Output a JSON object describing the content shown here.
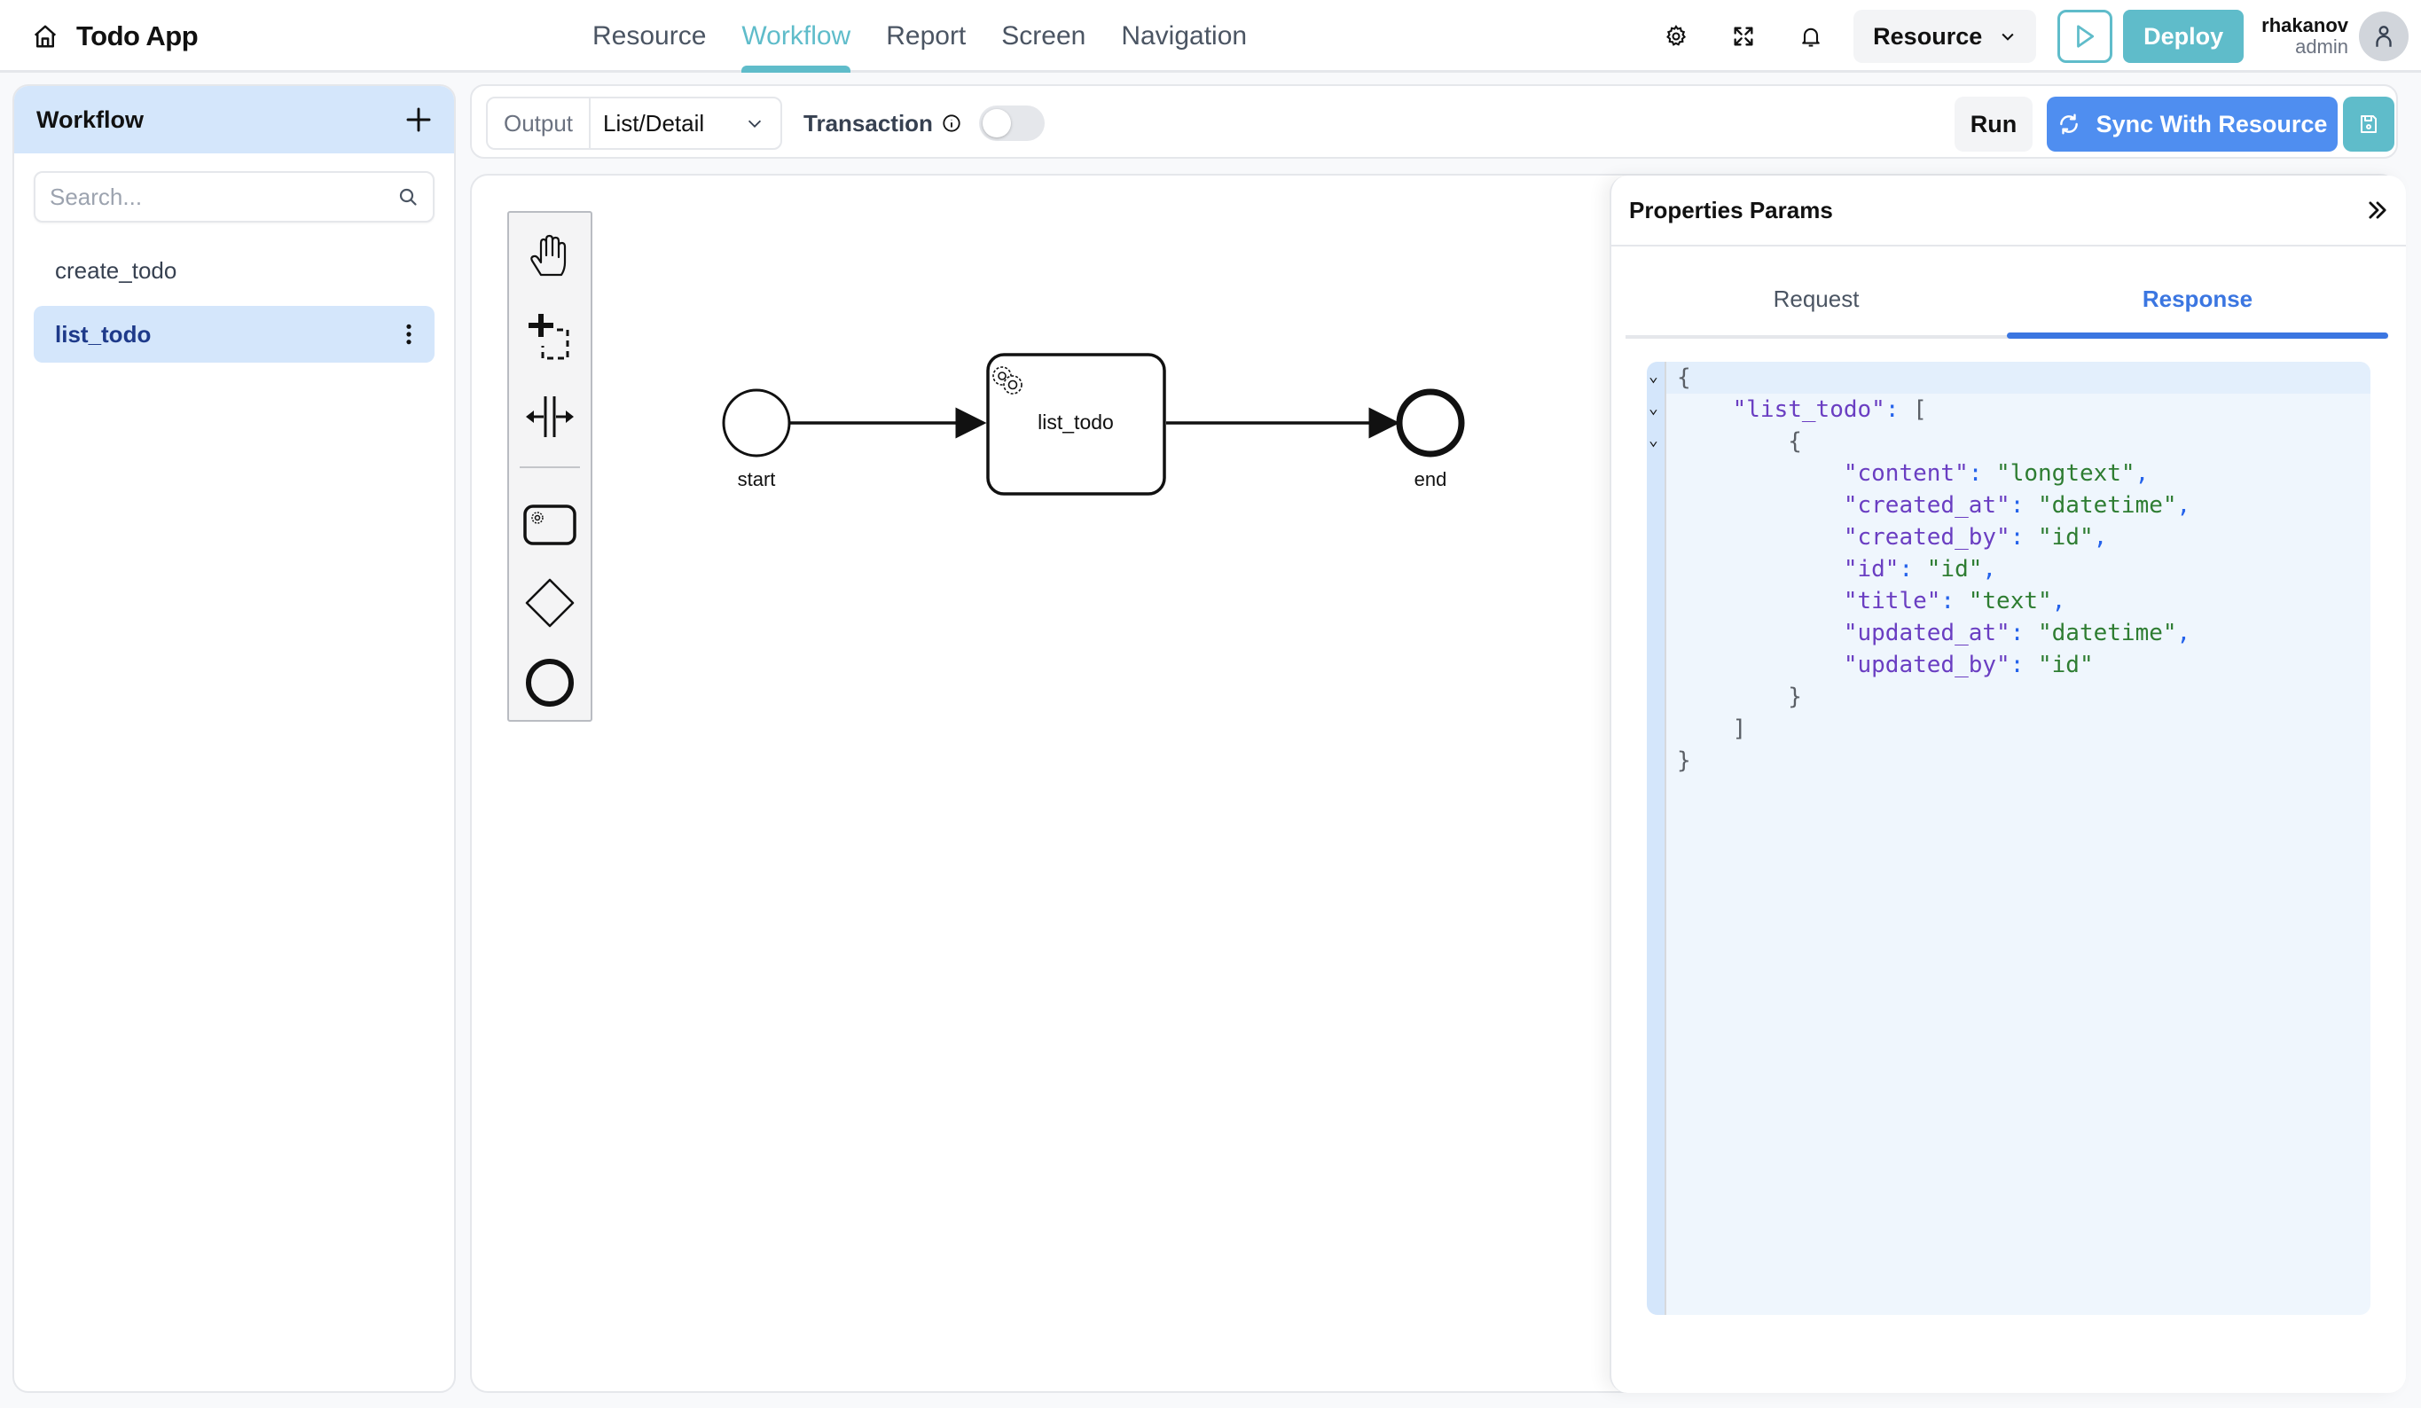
{
  "app": {
    "title": "Todo App",
    "home_icon": "home-icon"
  },
  "nav": {
    "tabs": [
      {
        "label": "Resource",
        "active": false
      },
      {
        "label": "Workflow",
        "active": true
      },
      {
        "label": "Report",
        "active": false
      },
      {
        "label": "Screen",
        "active": false
      },
      {
        "label": "Navigation",
        "active": false
      }
    ],
    "accent_color": "#5fbcca"
  },
  "header_actions": {
    "icons": [
      "gear-icon",
      "fullscreen-icon",
      "bell-icon"
    ],
    "resource_select": "Resource",
    "deploy_label": "Deploy",
    "user": {
      "name": "rhakanov",
      "role": "admin"
    }
  },
  "sidebar": {
    "title": "Workflow",
    "search_placeholder": "Search...",
    "search_value": "",
    "items": [
      {
        "label": "create_todo",
        "active": false
      },
      {
        "label": "list_todo",
        "active": true
      }
    ]
  },
  "toolbar": {
    "output_label": "Output",
    "output_value": "List/Detail",
    "transaction_label": "Transaction",
    "transaction_enabled": false,
    "run_label": "Run",
    "sync_label": "Sync With Resource",
    "sync_color": "#4f8ef0"
  },
  "palette": {
    "tools": [
      "hand-tool-icon",
      "lasso-tool-icon",
      "space-tool-icon",
      "service-task-icon",
      "gateway-icon",
      "end-event-icon"
    ]
  },
  "diagram": {
    "nodes": [
      {
        "id": "start",
        "type": "start-event",
        "label": "start"
      },
      {
        "id": "list_todo",
        "type": "service-task",
        "label": "list_todo"
      },
      {
        "id": "end",
        "type": "end-event",
        "label": "end"
      }
    ],
    "edges": [
      {
        "from": "start",
        "to": "list_todo"
      },
      {
        "from": "list_todo",
        "to": "end"
      }
    ]
  },
  "properties": {
    "title": "Properties Params",
    "tabs": [
      {
        "label": "Request",
        "active": false
      },
      {
        "label": "Response",
        "active": true
      }
    ],
    "response_json": {
      "root_key": "list_todo",
      "fields": [
        {
          "key": "content",
          "value": "longtext"
        },
        {
          "key": "created_at",
          "value": "datetime"
        },
        {
          "key": "created_by",
          "value": "id"
        },
        {
          "key": "id",
          "value": "id"
        },
        {
          "key": "title",
          "value": "text"
        },
        {
          "key": "updated_at",
          "value": "datetime"
        },
        {
          "key": "updated_by",
          "value": "id"
        }
      ]
    }
  }
}
